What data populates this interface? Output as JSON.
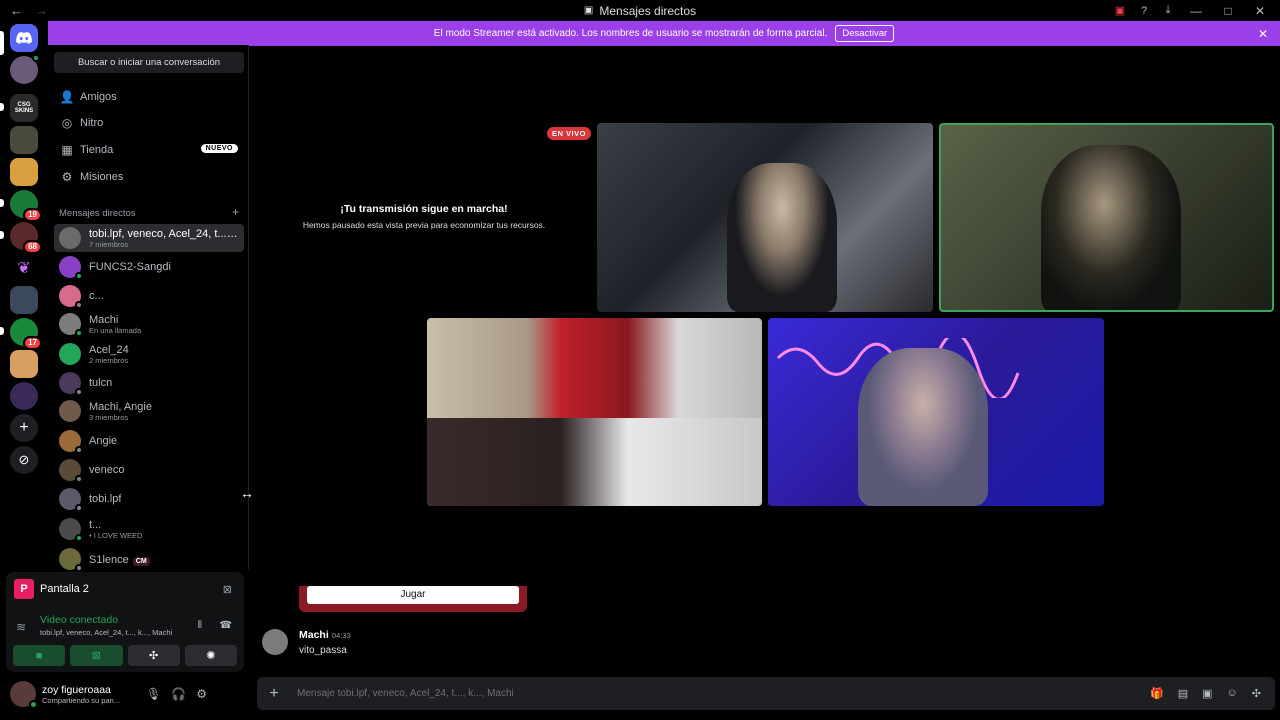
{
  "window": {
    "title": "Mensajes directos",
    "nav_back": "←",
    "nav_fwd": "→"
  },
  "banner": {
    "text": "El modo Streamer está activado. Los nombres de usuario se mostrarán de forma parcial.",
    "button": "Desactivar"
  },
  "sidebar": {
    "search": "Buscar o iniciar una conversación",
    "nav": [
      {
        "label": "Amigos",
        "icon": "friends-icon"
      },
      {
        "label": "Nitro",
        "icon": "nitro-icon"
      },
      {
        "label": "Tienda",
        "icon": "shop-icon",
        "badge": "NUEVO"
      },
      {
        "label": "Misiones",
        "icon": "quests-icon"
      }
    ],
    "dm_header": "Mensajes directos",
    "dms": [
      {
        "name": "tobi.lpf, veneco, Acel_24, t..., k...",
        "sub": "7 miembros",
        "color": "#6b6b6b",
        "status": ""
      },
      {
        "name": "FUNCS2-Sangdi",
        "sub": "",
        "color": "#8a3fc7",
        "status": "#23a55a"
      },
      {
        "name": "c...",
        "sub": "",
        "color": "#d86a8a",
        "status": "#80848e"
      },
      {
        "name": "Machi",
        "sub": "En una llamada",
        "color": "#7c7c7c",
        "status": "#23a55a"
      },
      {
        "name": "Acel_24",
        "sub": "2 miembros",
        "color": "#23a55a",
        "status": ""
      },
      {
        "name": "tulcn",
        "sub": "",
        "color": "#4a3a5c",
        "status": "#80848e"
      },
      {
        "name": "Machi, Angie",
        "sub": "3 miembros",
        "color": "#6e5a4a",
        "status": ""
      },
      {
        "name": "Angie",
        "sub": "",
        "color": "#9a6a3a",
        "status": "#80848e"
      },
      {
        "name": "veneco",
        "sub": "",
        "color": "#5a4a3a",
        "status": "#80848e"
      },
      {
        "name": "tobi.lpf",
        "sub": "",
        "color": "#5a5a6a",
        "status": "#80848e"
      },
      {
        "name": "t...",
        "sub": "• I LOVE WEED",
        "color": "#4a4a4a",
        "status": "#23a55a"
      },
      {
        "name": "S1lence",
        "sub": "",
        "color": "#6a6a3a",
        "status": "#80848e",
        "tag": "CM"
      }
    ]
  },
  "panel": {
    "screen_name": "Pantalla 2",
    "screen_logo": "P",
    "vc_title": "Video conectado",
    "vc_sub": "tobi.lpf, veneco, Acel_24, t..., k..., Machi"
  },
  "user": {
    "name": "zoy figueroaaa",
    "sub": "Compartiendo su pan..."
  },
  "call": {
    "live": "EN VIVO",
    "pause_title": "¡Tu transmisión sigue en marcha!",
    "pause_sub": "Hemos pausado esta vista previa para economizar tus recursos."
  },
  "chat": {
    "jugar": "Jugar",
    "author": "Machi",
    "time": "04:33",
    "text": "vito_passa",
    "placeholder": "Mensaje tobi.lpf, veneco, Acel_24, t..., k..., Machi"
  },
  "servers": [
    {
      "icon": "discord-icon",
      "color": "#5865f2",
      "badge": ""
    },
    {
      "icon": "avatar",
      "color": "#6a5a7a",
      "badge": ""
    },
    {
      "icon": "csgo-skins-icon",
      "color": "#2a2a2a",
      "badge": "",
      "text": "CSG SKINS"
    },
    {
      "icon": "server-icon",
      "color": "#4a4a3a",
      "badge": ""
    },
    {
      "icon": "bread-icon",
      "color": "#d8a040",
      "badge": ""
    },
    {
      "icon": "server-icon",
      "color": "#1a7a3a",
      "badge": "19"
    },
    {
      "icon": "server-icon",
      "color": "#5a2a2a",
      "badge": "68"
    },
    {
      "icon": "butterfly-icon",
      "color": "#000",
      "badge": ""
    },
    {
      "icon": "server-icon",
      "color": "#3a4a5a",
      "badge": ""
    },
    {
      "icon": "server-icon",
      "color": "#1a8a3a",
      "badge": "17"
    },
    {
      "icon": "server-icon",
      "color": "#d8a060",
      "badge": ""
    },
    {
      "icon": "server-icon",
      "color": "#3a2a5a",
      "badge": ""
    }
  ]
}
